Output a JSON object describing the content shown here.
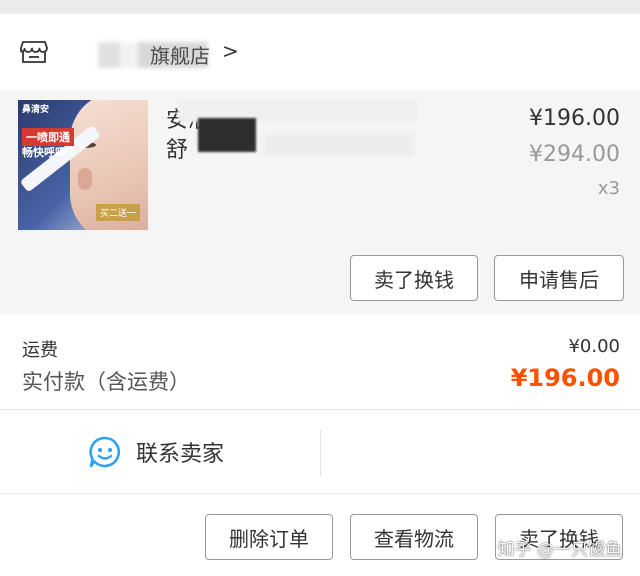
{
  "shop": {
    "name": "旗舰店",
    "chevron": ">",
    "icon": "store-icon"
  },
  "product": {
    "title_line1": "安液                    青",
    "title_line2": "舒",
    "price": "¥196.00",
    "original_price": "¥294.00",
    "quantity": "x3",
    "thumb": {
      "brand_text": "鼻清安",
      "badge_a": "一喷即通",
      "badge_b": "畅快呼吸",
      "promo": "买二送一"
    },
    "buttons": {
      "sell": "卖了换钱",
      "after_sale": "申请售后"
    }
  },
  "summary": {
    "shipping_label": "运费",
    "shipping_value": "¥0.00",
    "paid_label": "实付款（含运费）",
    "paid_value": "¥196.00",
    "accent_color": "#ff5000"
  },
  "contact": {
    "label": "联系卖家",
    "icon": "chat-smile-icon",
    "icon_color": "#2ba2f3"
  },
  "actions": {
    "delete": "删除订单",
    "logistics": "查看物流",
    "sell": "卖了换钱"
  },
  "watermark": "知乎 @一只馒鱼"
}
